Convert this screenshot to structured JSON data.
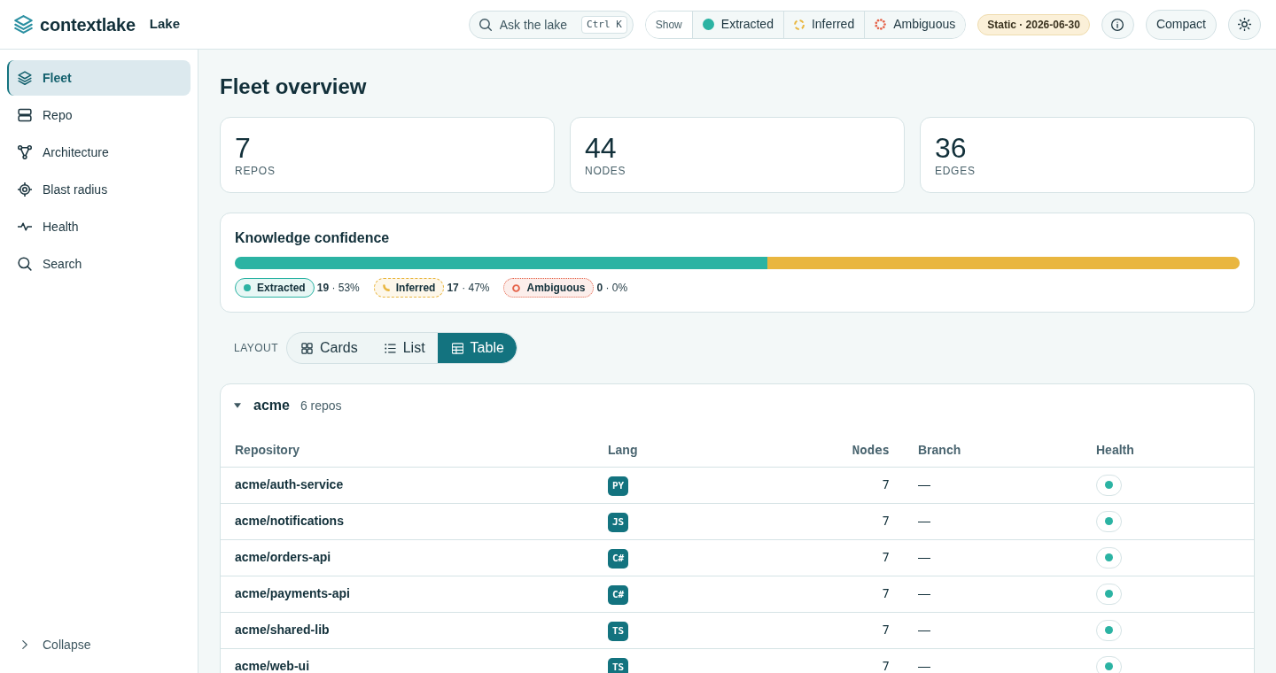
{
  "header": {
    "brand": "contextlake",
    "workspace": "Lake",
    "search": {
      "placeholder": "Ask the lake",
      "shortcut": "Ctrl K"
    },
    "show_filter": {
      "label": "Show",
      "options": [
        {
          "label": "Extracted",
          "kind": "solid",
          "color": "#2bb3a3"
        },
        {
          "label": "Inferred",
          "kind": "dashed",
          "color": "#e9b63f"
        },
        {
          "label": "Ambiguous",
          "kind": "dotted",
          "color": "#e5644b"
        }
      ]
    },
    "snapshot_badge": "Static · 2026-06-30",
    "compact_button": "Compact"
  },
  "sidebar": {
    "items": [
      {
        "label": "Fleet",
        "selected": true
      },
      {
        "label": "Repo",
        "selected": false
      },
      {
        "label": "Architecture",
        "selected": false
      },
      {
        "label": "Blast radius",
        "selected": false
      },
      {
        "label": "Health",
        "selected": false
      },
      {
        "label": "Search",
        "selected": false
      }
    ],
    "collapse": "Collapse"
  },
  "page_title": "Fleet overview",
  "stats": [
    {
      "value": "7",
      "label": "REPOS"
    },
    {
      "value": "44",
      "label": "NODES"
    },
    {
      "value": "36",
      "label": "EDGES"
    }
  ],
  "confidence": {
    "title": "Knowledge confidence",
    "segments": [
      {
        "label": "Extracted",
        "kind": "solid",
        "color": "#2bb3a3",
        "level": 0.53,
        "reading": "**19** · 53%"
      },
      {
        "label": "Inferred",
        "kind": "dashed",
        "color": "#e9b63f",
        "level": 0.47,
        "reading": "**17** · 47%"
      },
      {
        "label": "Ambiguous",
        "kind": "dotted",
        "color": "#e5644b",
        "reading": "**0** · 0%"
      }
    ]
  },
  "layout_switch": {
    "label": "LAYOUT",
    "options": [
      {
        "label": "Cards",
        "selected": false
      },
      {
        "label": "List",
        "selected": false
      },
      {
        "label": "Table",
        "selected": true
      }
    ]
  },
  "groups": [
    {
      "name": "acme",
      "count": "6 repos",
      "expanded": true,
      "columns": [
        "Repository",
        "Lang",
        "Nodes",
        "Branch",
        "Health"
      ],
      "rows": [
        {
          "repository": "acme/auth-service",
          "lang": "PY",
          "nodes": "7",
          "branch": "—",
          "health": {
            "color": "#2bb3a3"
          }
        },
        {
          "repository": "acme/notifications",
          "lang": "JS",
          "nodes": "7",
          "branch": "—",
          "health": {
            "color": "#2bb3a3"
          }
        },
        {
          "repository": "acme/orders-api",
          "lang": "C#",
          "nodes": "7",
          "branch": "—",
          "health": {
            "color": "#2bb3a3"
          }
        },
        {
          "repository": "acme/payments-api",
          "lang": "C#",
          "nodes": "7",
          "branch": "—",
          "health": {
            "color": "#2bb3a3"
          }
        },
        {
          "repository": "acme/shared-lib",
          "lang": "TS",
          "nodes": "7",
          "branch": "—",
          "health": {
            "color": "#2bb3a3"
          }
        },
        {
          "repository": "acme/web-ui",
          "lang": "TS",
          "nodes": "7",
          "branch": "—",
          "health": {
            "color": "#2bb3a3"
          }
        }
      ]
    }
  ]
}
